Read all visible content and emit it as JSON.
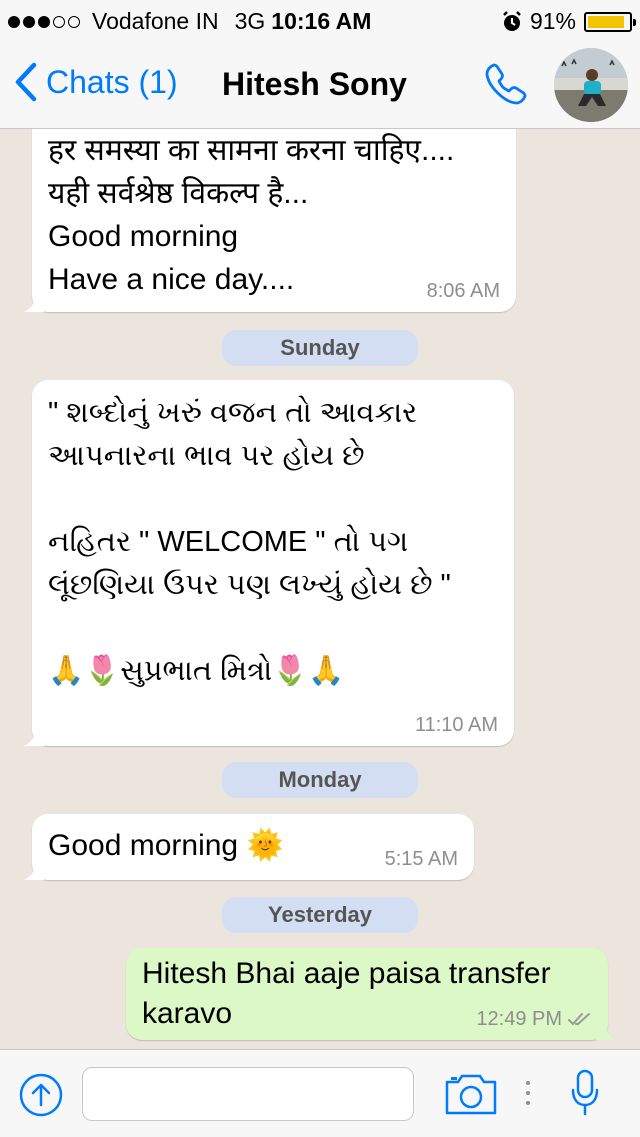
{
  "status_bar": {
    "carrier": "Vodafone IN",
    "network": "3G",
    "time": "10:16 AM",
    "battery": "91%",
    "battery_level": 0.91
  },
  "nav": {
    "back_label": "Chats (1)",
    "contact_name": "Hitesh Sony"
  },
  "messages": [
    {
      "lines": "हर समस्या का सामना करना चाहिए....\nयही सर्वश्रेष्ठ विकल्प है...\nGood morning\nHave a nice day....",
      "time": "8:06 AM"
    },
    {
      "text": "\" શબ્દોનું ખરું વજન તો આવકાર\nઆપનારના ભાવ પર હોય છે\n\nનહિતર \" WELCOME \" તો પગ\nલૂંછણિયા ઉપર પણ લખ્યું હોય છે \"\n\n🙏🌷સુપ્રભાત મિત્રો🌷🙏",
      "time": "11:10 AM"
    },
    {
      "text": "Good morning 🌞",
      "time": "5:15 AM"
    },
    {
      "text": "Hitesh Bhai aaje paisa transfer\nkaravo",
      "time": "12:49 PM"
    }
  ],
  "date_separators": [
    "Sunday",
    "Monday",
    "Yesterday"
  ],
  "icons": {
    "back": "chevron-left-icon",
    "call": "phone-icon",
    "attach": "arrow-up-circle-icon",
    "camera": "camera-icon",
    "mic": "microphone-icon",
    "read": "double-check-icon"
  },
  "colors": {
    "accent": "#007aff",
    "outgoing_bubble": "#dcf8c6",
    "incoming_bubble": "#ffffff",
    "chat_background": "#ece5dd",
    "date_pill": "#d4def3"
  }
}
